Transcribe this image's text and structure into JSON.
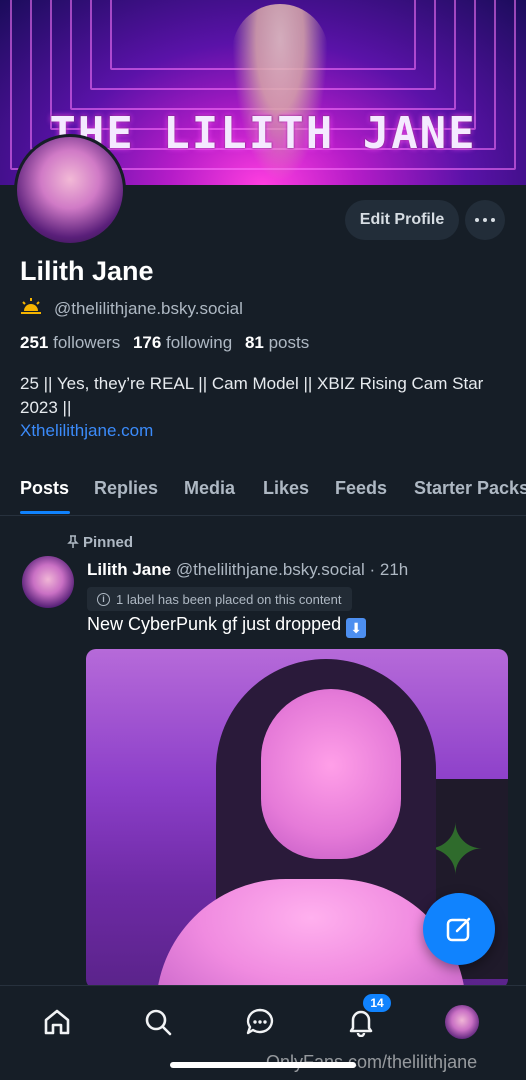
{
  "banner": {
    "title": "THE LILITH JANE"
  },
  "profile": {
    "edit_label": "Edit Profile",
    "name": "Lilith Jane",
    "handle": "@thelilithjane.bsky.social",
    "followers_count": "251",
    "followers_label": "followers",
    "following_count": "176",
    "following_label": "following",
    "posts_count": "81",
    "posts_label": "posts",
    "bio": "25 || Yes, they’re REAL || Cam Model || XBIZ Rising Cam Star 2023 ||",
    "link": "Xthelilithjane.com"
  },
  "tabs": [
    "Posts",
    "Replies",
    "Media",
    "Likes",
    "Feeds",
    "Starter Packs"
  ],
  "post": {
    "pinned_label": "Pinned",
    "author_name": "Lilith Jane",
    "author_handle": "@thelilithjane.bsky.social",
    "separator": "·",
    "time": "21h",
    "label_notice": "1 label has been placed on this content",
    "text": "New CyberPunk gf just dropped"
  },
  "nav": {
    "notifications_badge": "14"
  },
  "watermark": "OnlyFans.com/thelilithjane",
  "colors": {
    "accent": "#1083fe",
    "link": "#3b8bfa",
    "background": "#161e27"
  }
}
